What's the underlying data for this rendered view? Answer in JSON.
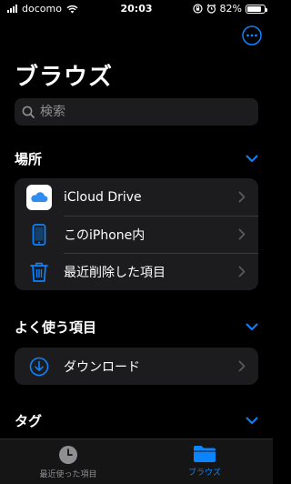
{
  "status": {
    "carrier": "docomo",
    "time": "20:03",
    "battery": "82%",
    "battery_level": 0.82
  },
  "header": {
    "title": "ブラウズ",
    "more_icon": "ellipsis-circle-icon"
  },
  "search": {
    "placeholder": "検索"
  },
  "sections": {
    "locations": {
      "label": "場所",
      "items": [
        {
          "label": "iCloud Drive",
          "icon": "icloud-icon"
        },
        {
          "label": "このiPhone内",
          "icon": "iphone-icon"
        },
        {
          "label": "最近削除した項目",
          "icon": "trash-icon"
        }
      ]
    },
    "favorites": {
      "label": "よく使う項目",
      "items": [
        {
          "label": "ダウンロード",
          "icon": "download-circle-icon"
        }
      ]
    },
    "tags": {
      "label": "タグ"
    }
  },
  "tabbar": {
    "tabs": [
      {
        "label": "最近使った項目",
        "icon": "clock-icon",
        "active": false
      },
      {
        "label": "ブラウズ",
        "icon": "folder-icon",
        "active": true
      }
    ]
  },
  "colors": {
    "accent": "#0a84ff",
    "background": "#000000",
    "cell": "#1c1c1e",
    "secondary": "#8e8e93"
  }
}
